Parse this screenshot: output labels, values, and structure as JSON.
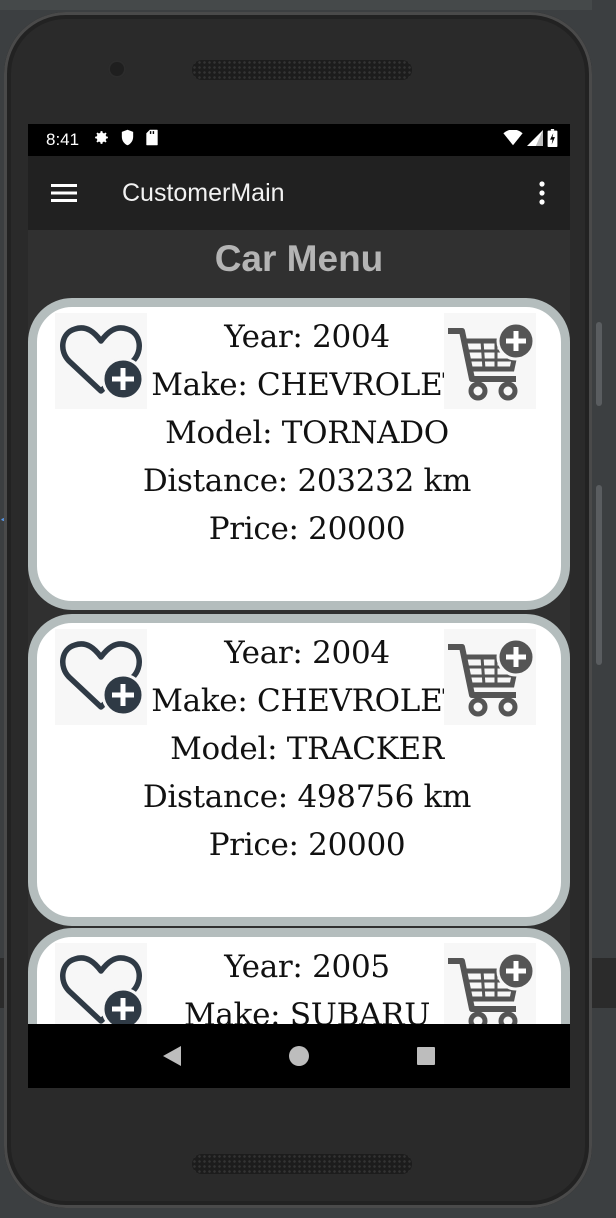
{
  "status_bar": {
    "time": "8:41",
    "left_icons": [
      "gear-icon",
      "shield-icon",
      "sd-card-icon"
    ],
    "right_icons": [
      "wifi-icon",
      "signal-icon",
      "battery-icon"
    ]
  },
  "app_bar": {
    "title": "CustomerMain",
    "menu_icon": "hamburger-menu-icon",
    "overflow_icon": "more-vert-icon"
  },
  "page": {
    "title": "Car Menu"
  },
  "cars": [
    {
      "year": "Year: 2004",
      "make": "Make: CHEVROLET",
      "model": "Model: TORNADO",
      "distance": "Distance: 203232 km",
      "price": "Price: 20000"
    },
    {
      "year": "Year: 2004",
      "make": "Make: CHEVROLET",
      "model": "Model: TRACKER",
      "distance": "Distance: 498756 km",
      "price": "Price: 20000"
    },
    {
      "year": "Year: 2005",
      "make": "Make: SUBARU"
    }
  ],
  "icons": {
    "favorite_add": "heart-plus-icon",
    "cart_add": "cart-plus-icon"
  },
  "nav_bar": {
    "back": "back-triangle-icon",
    "home": "home-circle-icon",
    "recents": "recents-square-icon"
  },
  "colors": {
    "card_border": "#b4bdbd",
    "icon_dark": "#2f3a45",
    "cart_gray": "#555555",
    "app_bar": "#212121",
    "page_title": "#b4b4b4"
  }
}
